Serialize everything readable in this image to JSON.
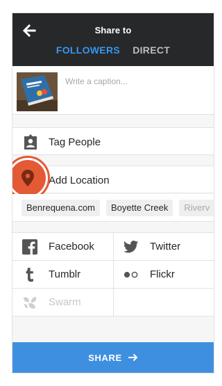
{
  "header": {
    "title": "Share to",
    "tabs": [
      {
        "label": "FOLLOWERS",
        "active": true
      },
      {
        "label": "DIRECT",
        "active": false
      }
    ]
  },
  "caption": {
    "placeholder": "Write a caption...",
    "value": ""
  },
  "rows": {
    "tag_people": "Tag People",
    "add_location": "Add Location"
  },
  "location_suggestions": [
    "Benrequena.com",
    "Boyette Creek",
    "Riverv"
  ],
  "share_targets": [
    {
      "label": "Facebook",
      "icon": "facebook-icon",
      "enabled": true
    },
    {
      "label": "Twitter",
      "icon": "twitter-icon",
      "enabled": true
    },
    {
      "label": "Tumblr",
      "icon": "tumblr-icon",
      "enabled": true
    },
    {
      "label": "Flickr",
      "icon": "flickr-icon",
      "enabled": true
    },
    {
      "label": "Swarm",
      "icon": "swarm-icon",
      "enabled": false
    }
  ],
  "share_button": {
    "label": "SHARE"
  },
  "colors": {
    "header_bg": "#262829",
    "accent_blue": "#3897f0",
    "share_button_bg": "#3f8fe0",
    "location_highlight": "#e45a35"
  }
}
